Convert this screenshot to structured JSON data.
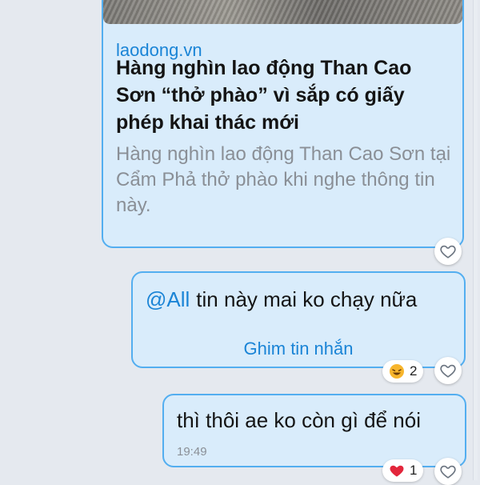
{
  "link_preview": {
    "domain": "laodong.vn",
    "title": "Hàng nghìn lao động Than Cao Sơn “thở phào” vì sắp có giấy phép khai thác mới",
    "description": "Hàng nghìn lao động Than Cao Sơn tại Cẩm Phả thở phào  khi nghe thông tin này."
  },
  "pinned_message": {
    "mention": "@All",
    "text": "tin này mai ko chạy nữa",
    "pin_action": "Ghim tin nhắn",
    "reaction": {
      "emoji": "laughing-emoji",
      "count": "2"
    }
  },
  "last_message": {
    "text": "thì thôi ae ko còn gì để nói",
    "time": "19:49",
    "reaction": {
      "emoji": "heart",
      "count": "1",
      "color": "#e3263b"
    }
  },
  "colors": {
    "accent": "#1a84d6",
    "bubble_bg": "#d9ecfb",
    "bubble_border": "#53aef0",
    "chat_bg": "#e5e9ef"
  }
}
